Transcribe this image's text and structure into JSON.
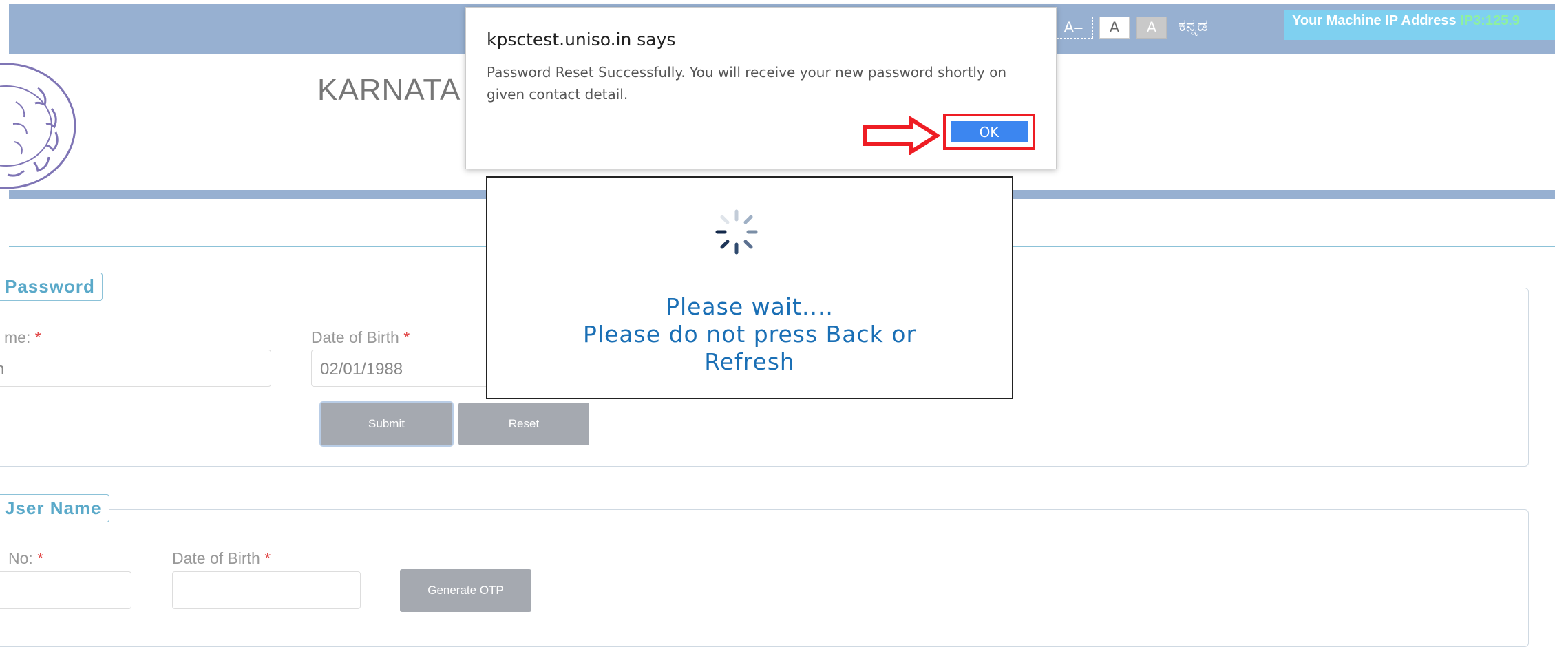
{
  "header": {
    "font_decrease": "A–",
    "font_normal": "A",
    "font_increase": "A",
    "language": "ಕನ್ನಡ",
    "ip_label": "Your Machine IP Address",
    "ip_value": "IP3:125.9"
  },
  "site": {
    "title": "KARNATA"
  },
  "forgot_password": {
    "legend": "Password",
    "name_label": "me:",
    "name_value": "n",
    "dob_label": "Date of Birth",
    "dob_value": "02/01/1988",
    "required_mark": "*",
    "submit": "Submit",
    "reset": "Reset"
  },
  "forgot_username": {
    "legend": "Jser Name",
    "no_label": "No:",
    "dob_label": "Date of Birth",
    "required_mark": "*",
    "generate_otp": "Generate OTP"
  },
  "alert": {
    "title": "kpsctest.uniso.in says",
    "message": "Password Reset Successfully. You will receive your new password shortly on given contact detail.",
    "ok": "OK"
  },
  "loading": {
    "line1": "Please wait....",
    "line2": "Please do not press Back or",
    "line3": "Refresh"
  },
  "colors": {
    "header_band": "#97b0d1",
    "ip_box": "#7fd0f0",
    "ok_button": "#3c86f0",
    "highlight": "#ee1d24",
    "wait_text": "#1a6fb5"
  }
}
